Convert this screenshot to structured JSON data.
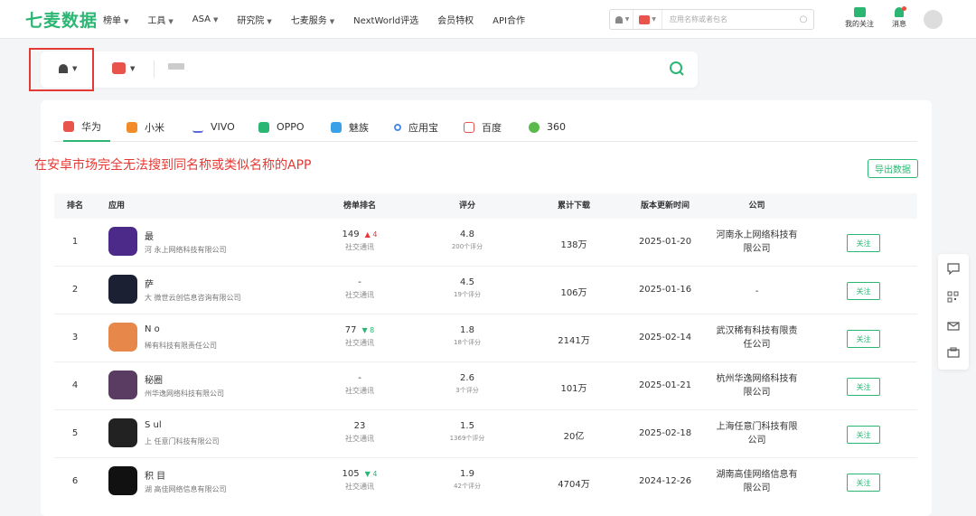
{
  "brand": {
    "logo": "七麦数据",
    "accent": "#2bb673"
  },
  "nav": [
    {
      "label": "榜单",
      "dropdown": true
    },
    {
      "label": "工具",
      "dropdown": true
    },
    {
      "label": "ASA",
      "dropdown": true
    },
    {
      "label": "研究院",
      "dropdown": true
    },
    {
      "label": "七麦服务",
      "dropdown": true
    },
    {
      "label": "NextWorld评选",
      "dropdown": false
    },
    {
      "label": "会员特权",
      "dropdown": false
    },
    {
      "label": "API合作",
      "dropdown": false
    }
  ],
  "top_search": {
    "placeholder": "应用名称或者包名"
  },
  "top_right": {
    "follow_label": "我的关注",
    "message_label": "消息"
  },
  "annotation": {
    "note": "在安卓市场完全无法搜到同名称或类似名称的APP",
    "highlight_color": "#e53935"
  },
  "tabs": [
    {
      "label": "华为",
      "active": true,
      "color": "#e8534b"
    },
    {
      "label": "小米",
      "active": false,
      "color": "#f28c28"
    },
    {
      "label": "VIVO",
      "active": false,
      "color": "#5b6bd6"
    },
    {
      "label": "OPPO",
      "active": false,
      "color": "#2bb673"
    },
    {
      "label": "魅族",
      "active": false,
      "color": "#3aa0e8"
    },
    {
      "label": "应用宝",
      "active": false,
      "color": "#4a8be8"
    },
    {
      "label": "百度",
      "active": false,
      "color": "#e8534b"
    },
    {
      "label": "360",
      "active": false,
      "color": "#59b94a"
    }
  ],
  "export_label": "导出数据",
  "table": {
    "headers": {
      "rank": "排名",
      "app": "应用",
      "list_rank": "榜单排名",
      "score": "评分",
      "downloads": "累计下载",
      "update": "版本更新时间",
      "company": "公司"
    },
    "follow_label": "关注",
    "rows": [
      {
        "rank": "1",
        "name_visible": "最",
        "company_visible": "河   永上网络科技有限公司",
        "list_rank": "149",
        "change": "4",
        "change_dir": "up",
        "category": "社交通讯",
        "score": "4.8",
        "score_count": "200个评分",
        "downloads": "138万",
        "update": "2025-01-20",
        "company_line1": "河南永上网络科技有",
        "company_line2": "限公司",
        "icon_color": "#4b2a8a"
      },
      {
        "rank": "2",
        "name_visible": "萨",
        "company_visible": "大   微世云创信息咨询有限公司",
        "list_rank": "-",
        "change": "",
        "change_dir": "",
        "category": "社交通讯",
        "score": "4.5",
        "score_count": "19个评分",
        "downloads": "106万",
        "update": "2025-01-16",
        "company_line1": "-",
        "company_line2": "",
        "icon_color": "#1c2033"
      },
      {
        "rank": "3",
        "name_visible": "N  o",
        "company_visible": "   稀有科技有限责任公司",
        "list_rank": "77",
        "change": "8",
        "change_dir": "down",
        "category": "社交通讯",
        "score": "1.8",
        "score_count": "18个评分",
        "downloads": "2141万",
        "update": "2025-02-14",
        "company_line1": "武汉稀有科技有限责",
        "company_line2": "任公司",
        "icon_color": "#e8874a"
      },
      {
        "rank": "4",
        "name_visible": "秘圈",
        "company_visible": "   州华逸网络科技有限公司",
        "list_rank": "-",
        "change": "",
        "change_dir": "",
        "category": "社交通讯",
        "score": "2.6",
        "score_count": "3个评分",
        "downloads": "101万",
        "update": "2025-01-21",
        "company_line1": "杭州华逸网络科技有",
        "company_line2": "限公司",
        "icon_color": "#5a3c62"
      },
      {
        "rank": "5",
        "name_visible": "S  ul",
        "company_visible": "上   任意门科技有限公司",
        "list_rank": "23",
        "change": "",
        "change_dir": "",
        "category": "社交通讯",
        "score": "1.5",
        "score_count": "1369个评分",
        "downloads": "20亿",
        "update": "2025-02-18",
        "company_line1": "上海任意门科技有限",
        "company_line2": "公司",
        "icon_color": "#222222"
      },
      {
        "rank": "6",
        "name_visible": "积  目",
        "company_visible": "湖   高佳网络信息有限公司",
        "list_rank": "105",
        "change": "4",
        "change_dir": "down",
        "category": "社交通讯",
        "score": "1.9",
        "score_count": "42个评分",
        "downloads": "4704万",
        "update": "2024-12-26",
        "company_line1": "湖南高佳网络信息有",
        "company_line2": "限公司",
        "icon_color": "#111111"
      }
    ]
  },
  "side_tools": [
    "chat-icon",
    "qrcode-icon",
    "mail-icon",
    "app-icon"
  ]
}
